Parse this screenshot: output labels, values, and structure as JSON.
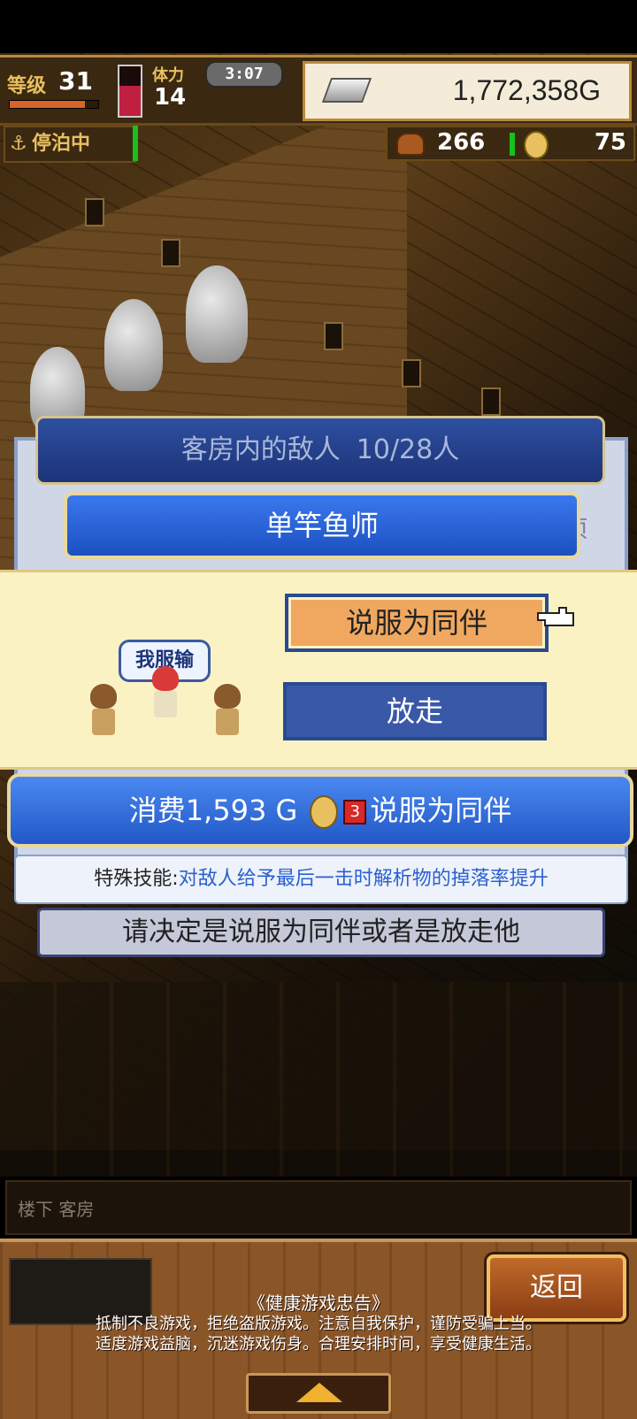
{
  "hud": {
    "level_label": "等级",
    "level_value": "31",
    "level_progress": 0.85,
    "stamina_label": "体力",
    "stamina_value": "14",
    "stamina_level": 0.6,
    "timer": "3:07",
    "gold": "1,772,358G",
    "status": "停泊中",
    "food": "266",
    "medals": "75"
  },
  "dialog": {
    "title": "客房内的敌人",
    "count": "10/28人",
    "enemy_name": "单竿鱼师",
    "side_hint": "项",
    "speech_bubble": "我服输",
    "persuade_label": "说服为同伴",
    "release_label": "放走",
    "cost_prefix": "消费1,593 G",
    "cost_medal_count": "3",
    "cost_suffix": "说服为同伴",
    "skill_label": "特殊技能:",
    "skill_text": "对敌人给予最后一击时解析物的掉落率提升",
    "prompt": "请决定是说服为同伴或者是放走他"
  },
  "footer": {
    "location": "楼下 客房",
    "back_label": "返回",
    "advisory_title": "《健康游戏忠告》",
    "advisory_line1": "抵制不良游戏，拒绝盗版游戏。注意自我保护，谨防受骗上当。",
    "advisory_line2": "适度游戏益脑，沉迷游戏伤身。合理安排时间，享受健康生活。"
  },
  "icons": {
    "anchor": "anchor-icon",
    "gold_bar": "silver-bar-icon",
    "meat": "meat-icon",
    "coin": "medal-coin-icon",
    "pointer": "hand-pointer-icon",
    "up": "up-arrow-icon"
  },
  "colors": {
    "title_bar": "#1c3378",
    "name_bar": "#3a78ee",
    "persuade_button": "#f0a860",
    "release_button": "#3a58a8",
    "skill_text": "#2a60d0"
  }
}
